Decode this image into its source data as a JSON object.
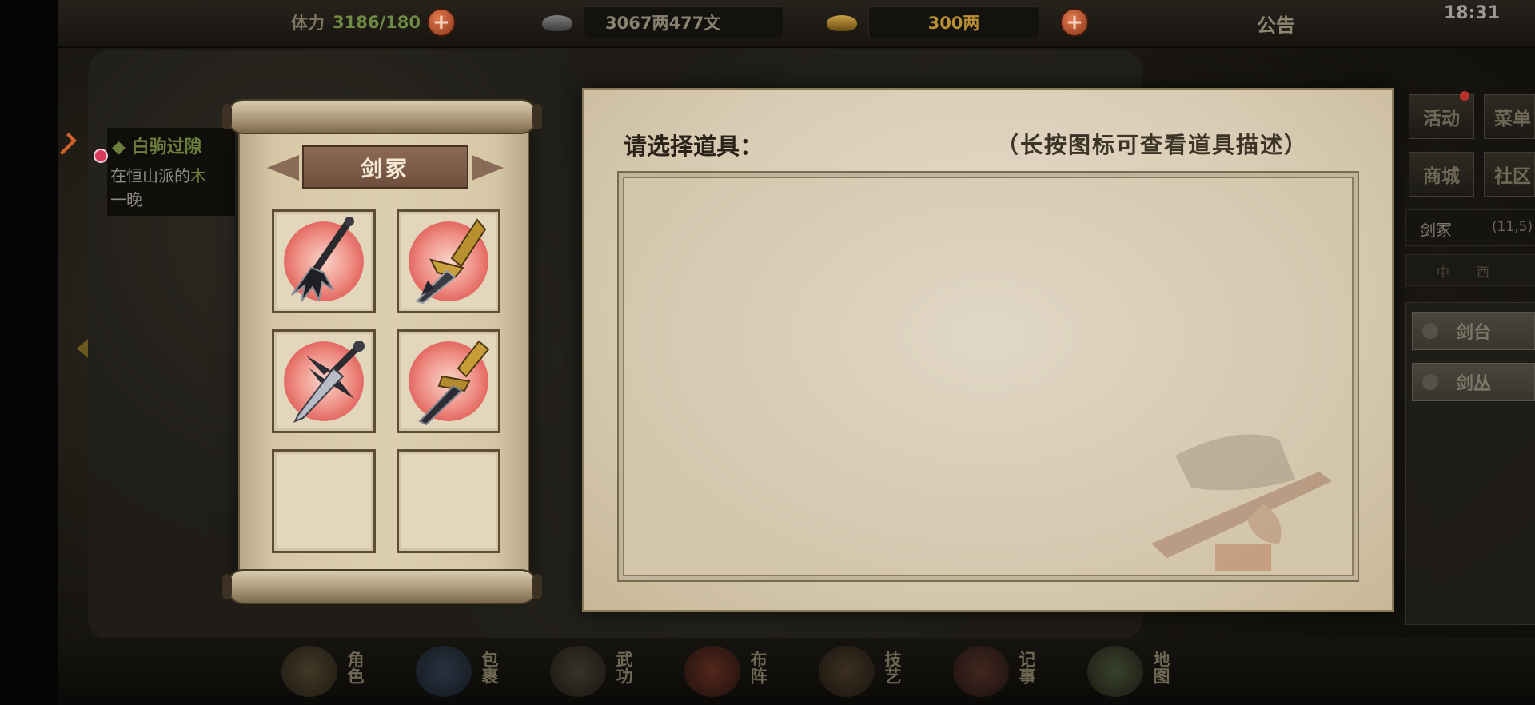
{
  "topbar": {
    "stamina_label": "体力",
    "stamina_value": "3186/180",
    "silver_value": "3067两477文",
    "gold_value": "300两",
    "notice_label": "公告",
    "clock": "18:31"
  },
  "quest": {
    "title": "◆ 白驹过隙",
    "line1": "在恒山派的",
    "line1_tail": "木",
    "line2": "一晚"
  },
  "inventory": {
    "title": "剑冢",
    "slots": [
      {
        "icon": "clawed-sword-icon",
        "filled": true
      },
      {
        "icon": "golden-broadsword-icon",
        "filled": true
      },
      {
        "icon": "spiked-blade-icon",
        "filled": true
      },
      {
        "icon": "golden-guard-sword-icon",
        "filled": true
      },
      {
        "icon": "empty-slot",
        "filled": false
      },
      {
        "icon": "empty-slot",
        "filled": false
      }
    ]
  },
  "selector": {
    "heading": "请选择道具：",
    "hint": "（长按图标可查看道具描述）"
  },
  "sidebar": {
    "activity": "活动",
    "menu": "菜单",
    "shop": "商城",
    "community": "社区",
    "location_name": "剑冢",
    "location_coord": "(11,5)",
    "compass_left": "中",
    "compass_right": "西",
    "zones": [
      "剑台",
      "剑丛"
    ]
  },
  "bottom_nav": [
    {
      "label": "角色",
      "icon": "character-icon"
    },
    {
      "label": "包裹",
      "icon": "bag-icon"
    },
    {
      "label": "武功",
      "icon": "martial-arts-icon"
    },
    {
      "label": "布阵",
      "icon": "formation-icon"
    },
    {
      "label": "技艺",
      "icon": "craft-icon"
    },
    {
      "label": "记事",
      "icon": "journal-icon"
    },
    {
      "label": "地图",
      "icon": "map-icon"
    }
  ],
  "colors": {
    "stamina_value": "#6f8a44",
    "gold_value": "#b98f36",
    "plate": "#7d5b47",
    "halo": "#ec7d74"
  }
}
